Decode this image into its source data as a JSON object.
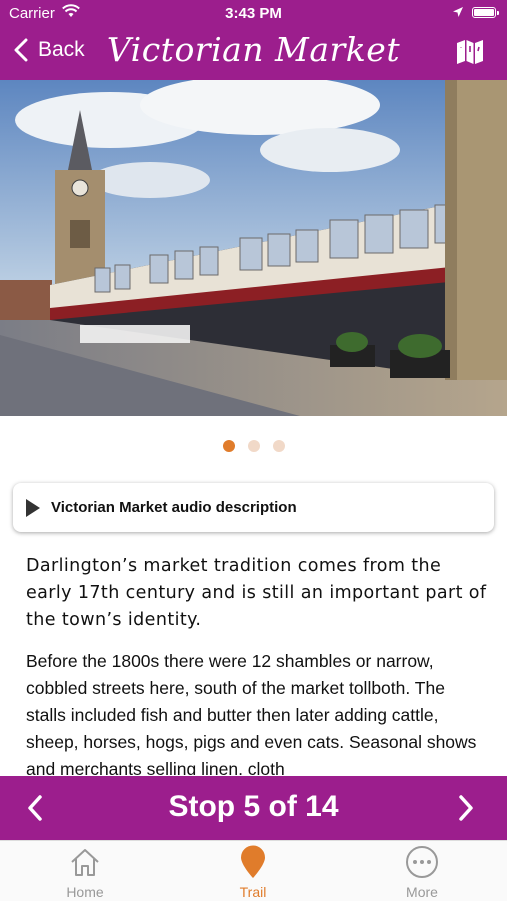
{
  "status_bar": {
    "carrier": "Carrier",
    "time": "3:43 PM"
  },
  "nav": {
    "back_label": "Back",
    "title": "Victorian Market"
  },
  "gallery": {
    "page_count": 3,
    "active_index": 0
  },
  "audio": {
    "label": "Victorian Market audio description"
  },
  "content": {
    "intro": "Darlington’s market tradition comes from the early 17th century and is still an important part of the town’s identity.",
    "body": "Before the 1800s there were 12 shambles or narrow, cobbled streets here, south of the market tollboth. The stalls included fish and butter then later adding cattle, sheep, horses, hogs, pigs and even cats. Seasonal shows and merchants selling linen, cloth"
  },
  "stop_nav": {
    "label": "Stop 5 of 14"
  },
  "tabs": [
    {
      "label": "Home",
      "icon": "home-icon",
      "active": false
    },
    {
      "label": "Trail",
      "icon": "map-pin-icon",
      "active": true
    },
    {
      "label": "More",
      "icon": "more-icon",
      "active": false
    }
  ],
  "colors": {
    "brand": "#9c1e8d",
    "accent": "#e07c2b",
    "inactive": "#999999"
  }
}
